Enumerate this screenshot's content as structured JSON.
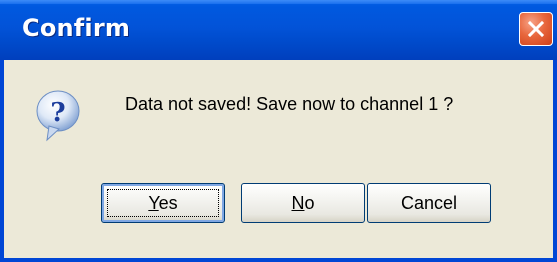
{
  "window": {
    "title": "Confirm"
  },
  "icons": {
    "message_icon": "question-icon",
    "close_icon": "close-icon"
  },
  "message": "Data not saved! Save now to channel 1 ?",
  "buttons": {
    "yes": {
      "mnemonic": "Y",
      "rest": "es"
    },
    "no": {
      "mnemonic": "N",
      "rest": "o"
    },
    "cancel": {
      "label": "Cancel"
    }
  },
  "colors": {
    "titlebar": "#0053d8",
    "close_button": "#e8673d",
    "dialog_background": "#ece9d8",
    "border": "#0046d5"
  }
}
